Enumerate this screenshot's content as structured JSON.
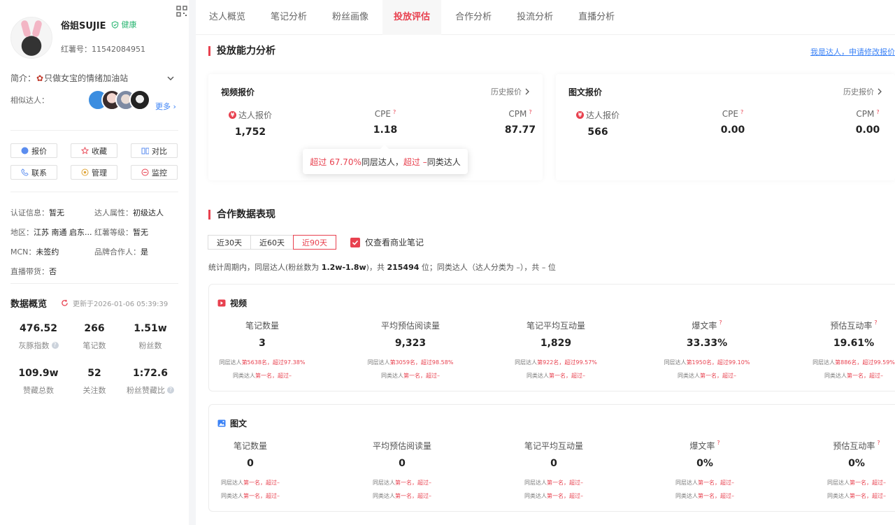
{
  "profile": {
    "nickname": "俗姐SUJIE",
    "health": "健康",
    "red_id": "红薯号：11542084951",
    "bio": "只做女宝的情绪加油站",
    "bio_label": "简介：",
    "similar_label": "相似达人：",
    "more_label": "更多"
  },
  "actions": [
    "报价",
    "收藏",
    "对比",
    "联系",
    "管理",
    "监控"
  ],
  "attributes": [
    {
      "label": "认证信息：",
      "value": "暂无"
    },
    {
      "label": "达人属性：",
      "value": "初级达人"
    },
    {
      "label": "地区：",
      "value": "江苏 南通 启东..."
    },
    {
      "label": "红薯等级：",
      "value": "暂无"
    },
    {
      "label": "MCN：",
      "value": "未签约"
    },
    {
      "label": "品牌合作人：",
      "value": "是"
    },
    {
      "label": "直播带货：",
      "value": "否"
    }
  ],
  "overview": {
    "title": "数据概览",
    "updated": "更新于2026-01-06 05:39:39",
    "stats": [
      {
        "value": "476.52",
        "label": "灰豚指数",
        "help": true
      },
      {
        "value": "266",
        "label": "笔记数",
        "help": false
      },
      {
        "value": "1.51w",
        "label": "粉丝数",
        "help": false
      },
      {
        "value": "109.9w",
        "label": "赞藏总数",
        "help": false
      },
      {
        "value": "52",
        "label": "关注数",
        "help": false
      },
      {
        "value": "1:72.6",
        "label": "粉丝赞藏比",
        "help": true
      }
    ]
  },
  "tabs": [
    "达人概览",
    "笔记分析",
    "粉丝画像",
    "投放评估",
    "合作分析",
    "投流分析",
    "直播分析"
  ],
  "active_tab": "投放评估",
  "ability": {
    "title": "投放能力分析",
    "edit_link": "我是达人，申请修改报价",
    "history_label": "历史报价",
    "video": {
      "title": "视频报价",
      "metrics": [
        {
          "label": "达人报价",
          "value": "1,752"
        },
        {
          "label": "CPE",
          "value": "1.18"
        },
        {
          "label": "CPM",
          "value": "87.77"
        }
      ]
    },
    "image": {
      "title": "图文报价",
      "metrics": [
        {
          "label": "达人报价",
          "value": "566"
        },
        {
          "label": "CPE",
          "value": "0.00"
        },
        {
          "label": "CPM",
          "value": "0.00"
        }
      ]
    },
    "tooltip": {
      "part1": "超过 67.70%",
      "part2": " 同层达人，",
      "part3": "超过 –",
      "part4": " 同类达人"
    }
  },
  "coop": {
    "title": "合作数据表现",
    "periods": [
      "近30天",
      "近60天",
      "近90天"
    ],
    "active_period": "近90天",
    "checkbox_label": "仅查看商业笔记",
    "desc_a": "统计周期内，同层达人(粉丝数为 ",
    "desc_range": "1.2w-1.8w",
    "desc_b": ")，共 ",
    "desc_count": "215494",
    "desc_c": " 位；同类达人（达人分类为 –），共 – 位",
    "video": {
      "title": "视频",
      "metrics": [
        {
          "label": "笔记数量",
          "value": "3",
          "r1a": "同层达人",
          "r1b": "第5638名，超过97.38%",
          "r2a": "同类达人",
          "r2b": "第一名，超过–",
          "help": false
        },
        {
          "label": "平均预估阅读量",
          "value": "9,323",
          "r1a": "同层达人",
          "r1b": "第3059名，超过98.58%",
          "r2a": "同类达人",
          "r2b": "第一名，超过–",
          "help": false
        },
        {
          "label": "笔记平均互动量",
          "value": "1,829",
          "r1a": "同层达人",
          "r1b": "第922名，超过99.57%",
          "r2a": "同类达人",
          "r2b": "第一名，超过–",
          "help": false
        },
        {
          "label": "爆文率",
          "value": "33.33%",
          "r1a": "同层达人",
          "r1b": "第1950名，超过99.10%",
          "r2a": "同类达人",
          "r2b": "第一名，超过–",
          "help": true
        },
        {
          "label": "预估互动率",
          "value": "19.61%",
          "r1a": "同层达人",
          "r1b": "第886名，超过99.59%",
          "r2a": "同类达人",
          "r2b": "第一名，超过–",
          "help": true
        }
      ]
    },
    "image": {
      "title": "图文",
      "metrics": [
        {
          "label": "笔记数量",
          "value": "0",
          "r1a": "同层达人",
          "r1b": "第一名，超过–",
          "r2a": "同类达人",
          "r2b": "第一名，超过–",
          "help": false
        },
        {
          "label": "平均预估阅读量",
          "value": "0",
          "r1a": "同层达人",
          "r1b": "第一名，超过–",
          "r2a": "同类达人",
          "r2b": "第一名，超过–",
          "help": false
        },
        {
          "label": "笔记平均互动量",
          "value": "0",
          "r1a": "同层达人",
          "r1b": "第一名，超过–",
          "r2a": "同类达人",
          "r2b": "第一名，超过–",
          "help": false
        },
        {
          "label": "爆文率",
          "value": "0%",
          "r1a": "同层达人",
          "r1b": "第一名，超过–",
          "r2a": "同类达人",
          "r2b": "第一名，超过–",
          "help": true
        },
        {
          "label": "预估互动率",
          "value": "0%",
          "r1a": "同层达人",
          "r1b": "第一名，超过–",
          "r2a": "同类达人",
          "r2b": "第一名，超过–",
          "help": true
        }
      ]
    }
  },
  "colors": {
    "accent": "#e8414f",
    "link": "#3b82f6",
    "health": "#2bb673"
  },
  "icons": [
    "qr-code-icon",
    "shield-check-icon",
    "rose-icon",
    "chevron-down-icon",
    "chevron-right-icon",
    "yen-icon",
    "refresh-icon",
    "video-icon",
    "image-icon",
    "checkbox-checked-icon"
  ]
}
